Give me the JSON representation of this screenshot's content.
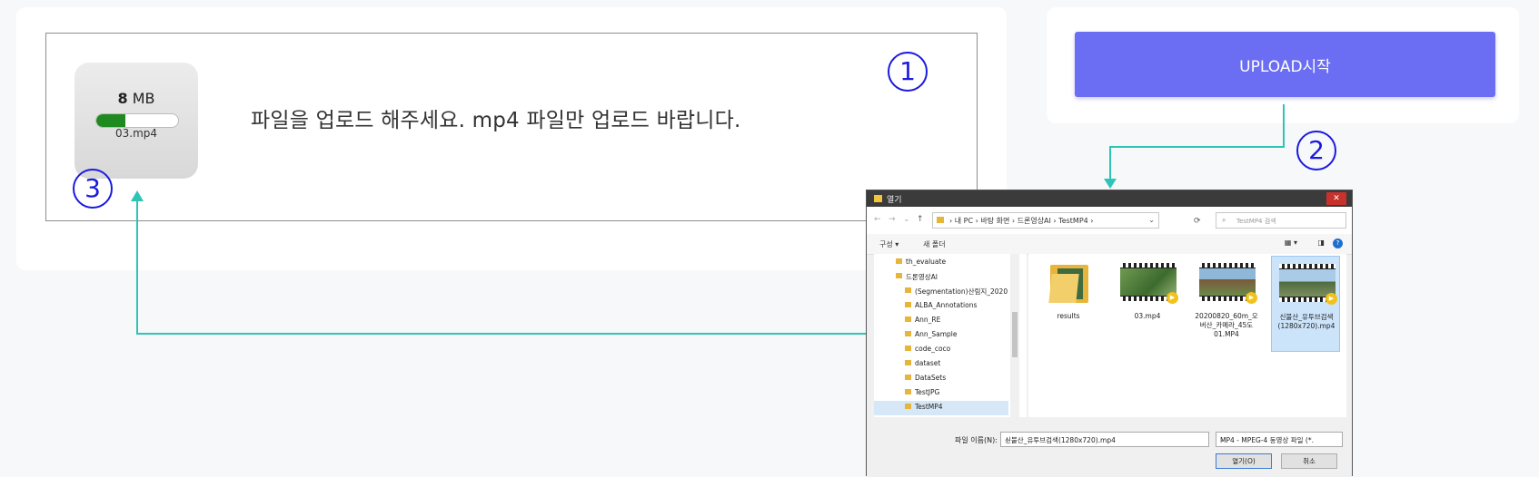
{
  "upload_area": {
    "file_size_value": "8",
    "file_size_unit": "MB",
    "file_name": "03.mp4",
    "progress_fraction": 0.35,
    "hint": "파일을 업로드 해주세요. mp4 파일만 업로드 바랍니다."
  },
  "upload_button": {
    "label": "UPLOAD시작"
  },
  "markers": {
    "m1": "1",
    "m2": "2",
    "m3": "3"
  },
  "colors": {
    "accent": "#6b6ef3",
    "connector": "#2ec4b6",
    "marker": "#1a1ae0",
    "progress": "#1f8a1f"
  },
  "file_dialog": {
    "title": "열기",
    "close": "✕",
    "address": {
      "parts": [
        "내 PC",
        "바탕 화면",
        "드론영상AI",
        "TestMP4"
      ],
      "text": "› 내 PC › 바탕 화면 › 드론영상AI › TestMP4 ›"
    },
    "search_placeholder": "TestMP4 검색",
    "toolbar": {
      "organize": "구성 ▾",
      "new_folder": "새 폴더",
      "help": "?"
    },
    "tree": [
      "th_evaluate",
      "드론영상AI",
      "(Segmentation)산림지_2020",
      "ALBA_Annotations",
      "Ann_RE",
      "Ann_Sample",
      "code_coco",
      "dataset",
      "DataSets",
      "TestJPG",
      "TestMP4"
    ],
    "files": [
      {
        "label": "results",
        "icon": "folder-icon"
      },
      {
        "label": "03.mp4",
        "icon": "video-icon"
      },
      {
        "label": "20200820_60m_오버산_카메라_45도01.MP4",
        "icon": "video-icon"
      },
      {
        "label": "신불산_유투브검색(1280x720).mp4",
        "icon": "video-icon"
      }
    ],
    "filename_label": "파일 이름(N):",
    "filename_value": "신불산_유투브검색(1280x720).mp4",
    "filetype_value": "MP4 - MPEG-4 동영상 파일 (*.",
    "open_label": "열기(O)",
    "cancel_label": "취소"
  }
}
